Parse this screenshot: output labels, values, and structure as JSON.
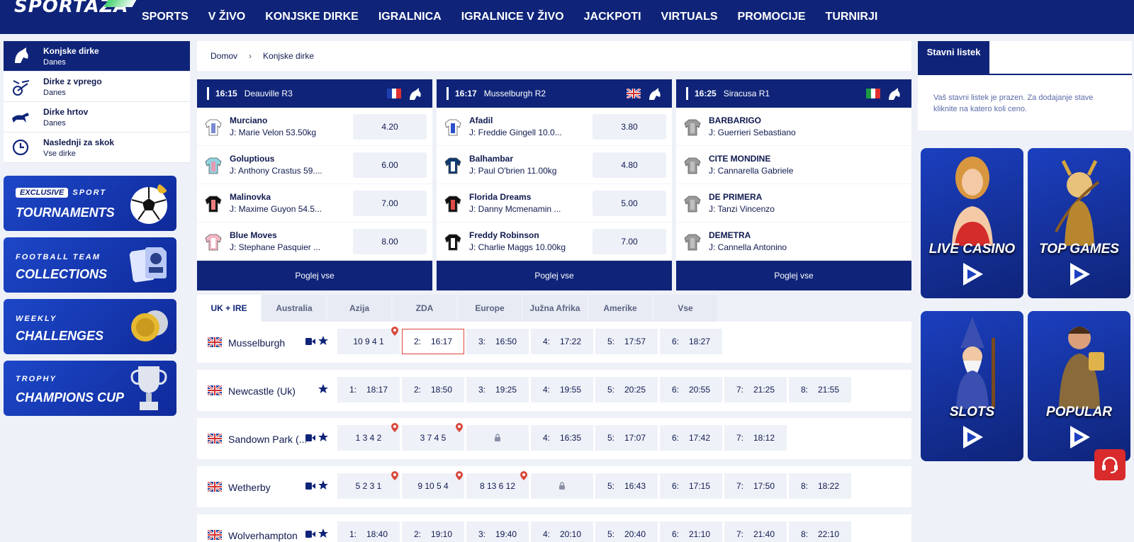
{
  "header": {
    "logo_text": "SPORTAZA",
    "nav": [
      "SPORTS",
      "V ŽIVO",
      "KONJSKE DIRKE",
      "IGRALNICA",
      "IGRALNICE V ŽIVO",
      "JACKPOTI",
      "VIRTUALS",
      "PROMOCIJE",
      "TURNIRJI"
    ]
  },
  "sidebar": {
    "items": [
      {
        "title": "Konjske dirke",
        "sub": "Danes",
        "icon": "horse-head-icon"
      },
      {
        "title": "Dirke z vprego",
        "sub": "Danes",
        "icon": "harness-cart-icon"
      },
      {
        "title": "Dirke hrtov",
        "sub": "Danes",
        "icon": "greyhound-icon"
      },
      {
        "title": "Naslednji za skok",
        "sub": "Vse dirke",
        "icon": "clock-icon"
      }
    ],
    "promos": [
      {
        "small": "SPORT",
        "badge": "EXCLUSIVE",
        "big": "TOURNAMENTS"
      },
      {
        "small": "FOOTBALL TEAM",
        "big": "COLLECTIONS"
      },
      {
        "small": "WEEKLY",
        "big": "CHALLENGES"
      },
      {
        "small": "TROPHY",
        "big": "CHAMPIONS CUP"
      }
    ]
  },
  "breadcrumb": {
    "home": "Domov",
    "current": "Konjske dirke"
  },
  "race_cards": [
    {
      "time": "16:15",
      "venue": "Deauville R3",
      "flag": "france-flag",
      "runners": [
        {
          "name": "Murciano",
          "jockey": "J: Marie Velon 53.50kg",
          "odds": "4.20"
        },
        {
          "name": "Goluptious",
          "jockey": "J: Anthony Crastus 59....",
          "odds": "6.00"
        },
        {
          "name": "Malinovka",
          "jockey": "J: Maxime Guyon 54.5...",
          "odds": "7.00"
        },
        {
          "name": "Blue Moves",
          "jockey": "J: Stephane Pasquier ...",
          "odds": "8.00"
        }
      ],
      "view_all": "Poglej vse"
    },
    {
      "time": "16:17",
      "venue": "Musselburgh R2",
      "flag": "uk-flag",
      "runners": [
        {
          "name": "Afadil",
          "jockey": "J: Freddie Gingell 10.0...",
          "odds": "3.80"
        },
        {
          "name": "Balhambar",
          "jockey": "J: Paul O'brien 11.00kg",
          "odds": "4.80"
        },
        {
          "name": "Florida Dreams",
          "jockey": "J: Danny Mcmenamin ...",
          "odds": "5.00"
        },
        {
          "name": "Freddy Robinson",
          "jockey": "J: Charlie Maggs 10.00kg",
          "odds": "7.00"
        }
      ],
      "view_all": "Poglej vse"
    },
    {
      "time": "16:25",
      "venue": "Siracusa R1",
      "flag": "italy-flag",
      "runners": [
        {
          "name": "BARBARIGO",
          "jockey": "J: Guerrieri Sebastiano",
          "odds": ""
        },
        {
          "name": "CITE MONDINE",
          "jockey": "J: Cannarella Gabriele",
          "odds": ""
        },
        {
          "name": "DE PRIMERA",
          "jockey": "J: Tanzi Vincenzo",
          "odds": ""
        },
        {
          "name": "DEMETRA",
          "jockey": "J: Cannella Antonino",
          "odds": ""
        }
      ],
      "view_all": "Poglej vse"
    }
  ],
  "tabs": [
    "UK + IRE",
    "Australia",
    "Azija",
    "ZDA",
    "Europe",
    "Južna Afrika",
    "Amerike",
    "Vse"
  ],
  "meetings": [
    {
      "name": "Musselburgh",
      "cam": true,
      "slots": [
        {
          "result": "10 9 4 1",
          "pin": true
        },
        {
          "n": "2:",
          "t": "16:17",
          "sel": true
        },
        {
          "n": "3:",
          "t": "16:50"
        },
        {
          "n": "4:",
          "t": "17:22"
        },
        {
          "n": "5:",
          "t": "17:57"
        },
        {
          "n": "6:",
          "t": "18:27"
        }
      ]
    },
    {
      "name": "Newcastle (Uk)",
      "cam": false,
      "slots": [
        {
          "n": "1:",
          "t": "18:17"
        },
        {
          "n": "2:",
          "t": "18:50"
        },
        {
          "n": "3:",
          "t": "19:25"
        },
        {
          "n": "4:",
          "t": "19:55"
        },
        {
          "n": "5:",
          "t": "20:25"
        },
        {
          "n": "6:",
          "t": "20:55"
        },
        {
          "n": "7:",
          "t": "21:25"
        },
        {
          "n": "8:",
          "t": "21:55"
        }
      ]
    },
    {
      "name": "Sandown Park (...",
      "cam": true,
      "slots": [
        {
          "result": "1 3 4 2",
          "pin": true
        },
        {
          "result": "3 7 4 5",
          "pin": true
        },
        {
          "lock": true
        },
        {
          "n": "4:",
          "t": "16:35"
        },
        {
          "n": "5:",
          "t": "17:07"
        },
        {
          "n": "6:",
          "t": "17:42"
        },
        {
          "n": "7:",
          "t": "18:12"
        }
      ]
    },
    {
      "name": "Wetherby",
      "cam": true,
      "slots": [
        {
          "result": "5 2 3 1",
          "pin": true
        },
        {
          "result": "9 10 5 4",
          "pin": true
        },
        {
          "result": "8 13 6 12",
          "pin": true
        },
        {
          "lock": true
        },
        {
          "n": "5:",
          "t": "16:43"
        },
        {
          "n": "6:",
          "t": "17:15"
        },
        {
          "n": "7:",
          "t": "17:50"
        },
        {
          "n": "8:",
          "t": "18:22"
        }
      ]
    },
    {
      "name": "Wolverhampton",
      "cam": true,
      "slots": [
        {
          "n": "1:",
          "t": "18:40"
        },
        {
          "n": "2:",
          "t": "19:10"
        },
        {
          "n": "3:",
          "t": "19:40"
        },
        {
          "n": "4:",
          "t": "20:10"
        },
        {
          "n": "5:",
          "t": "20:40"
        },
        {
          "n": "6:",
          "t": "21:10"
        },
        {
          "n": "7:",
          "t": "21:40"
        },
        {
          "n": "8:",
          "t": "22:10"
        }
      ]
    }
  ],
  "betslip": {
    "tab": "Stavni listek",
    "empty": "Vaš stavni listek je prazen. Za dodajanje stave kliknite na katero koli ceno."
  },
  "games": [
    "LIVE CASINO",
    "TOP GAMES",
    "SLOTS",
    "POPULAR"
  ],
  "colors": {
    "brand": "#0f2479",
    "background": "#eef1f8",
    "selected_border": "#d9473b",
    "support": "#d92b2b"
  }
}
